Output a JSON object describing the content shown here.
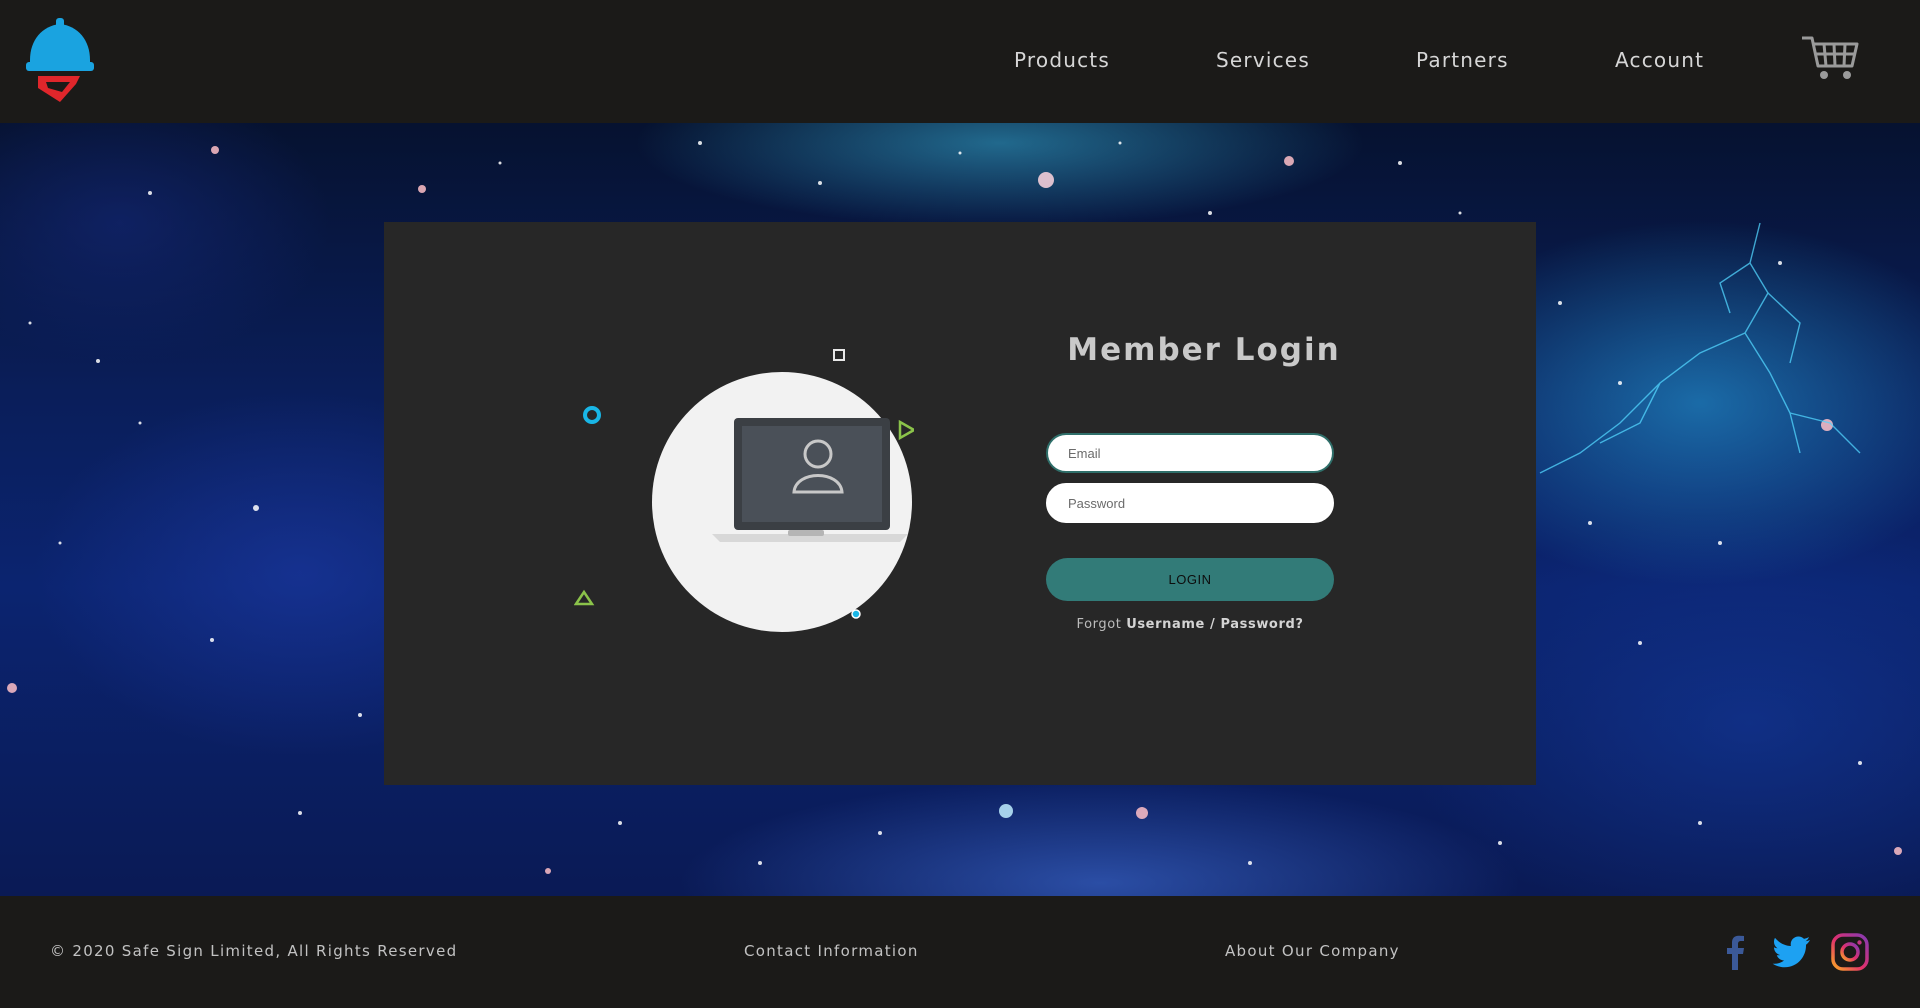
{
  "header": {
    "logo_icon": "safety-helmet-shield-logo",
    "nav": [
      {
        "label": "Products"
      },
      {
        "label": "Services"
      },
      {
        "label": "Partners"
      },
      {
        "label": "Account"
      }
    ],
    "cart_icon": "shopping-cart-icon"
  },
  "login": {
    "title": "Member Login",
    "email_placeholder": "Email",
    "password_placeholder": "Password",
    "button_label": "LOGIN",
    "forgot_prefix": "Forgot",
    "forgot_link": "Username / Password?",
    "illustration_icon": "laptop-user-icon"
  },
  "footer": {
    "copyright": "© 2020 Safe Sign Limited, All Rights Reserved",
    "contact": "Contact Information",
    "about": "About Our Company",
    "social": [
      "facebook-icon",
      "twitter-icon",
      "instagram-icon"
    ]
  },
  "colors": {
    "header_bg": "#1b1a18",
    "card_bg": "#272727",
    "button_teal": "#327b78",
    "logo_blue": "#1aa3e0",
    "logo_red": "#e0262b",
    "accent_cyan": "#19b6e6",
    "accent_green": "#8bc34a"
  }
}
